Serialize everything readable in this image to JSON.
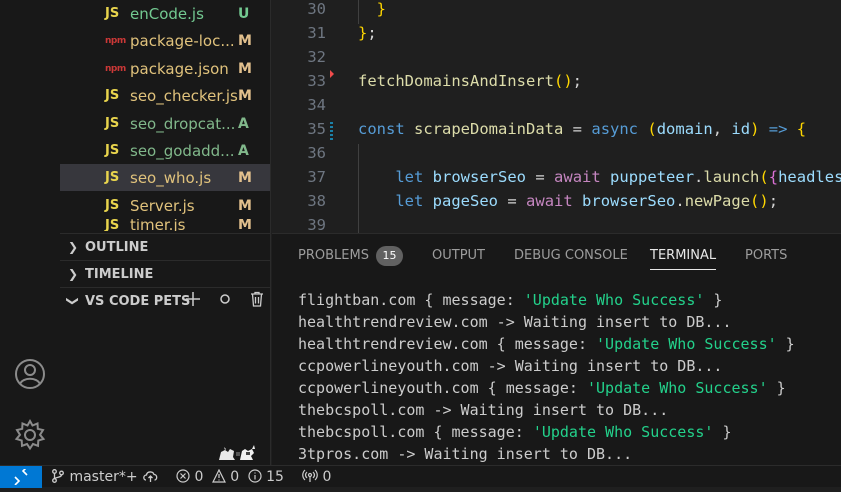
{
  "explorer": {
    "files": [
      {
        "icon": "js",
        "name": "enCode.js",
        "status": "U",
        "selected": false,
        "kind": "untracked"
      },
      {
        "icon": "npm",
        "name": "package-loc...",
        "status": "M",
        "selected": false,
        "kind": "modified"
      },
      {
        "icon": "npm",
        "name": "package.json",
        "status": "M",
        "selected": false,
        "kind": "modified"
      },
      {
        "icon": "js",
        "name": "seo_checker.js",
        "status": "M",
        "selected": false,
        "kind": "modified"
      },
      {
        "icon": "js",
        "name": "seo_dropcat...",
        "status": "A",
        "selected": false,
        "kind": "added"
      },
      {
        "icon": "js",
        "name": "seo_godadd...",
        "status": "A",
        "selected": false,
        "kind": "added"
      },
      {
        "icon": "js",
        "name": "seo_who.js",
        "status": "M",
        "selected": true,
        "kind": "modified"
      },
      {
        "icon": "js",
        "name": "Server.js",
        "status": "M",
        "selected": false,
        "kind": "modified"
      },
      {
        "icon": "js",
        "name": "timer.js",
        "status": "M",
        "selected": false,
        "kind": "modified"
      }
    ],
    "icon_labels": {
      "js": "JS",
      "npm": "npm"
    },
    "outline_title": "OUTLINE",
    "timeline_title": "TIMELINE",
    "pets_title": "VS CODE PETS"
  },
  "editor": {
    "lines": [
      {
        "n": "30",
        "text": "  }"
      },
      {
        "n": "31",
        "text": "};"
      },
      {
        "n": "32",
        "text": ""
      },
      {
        "n": "33",
        "text": "fetchDomainsAndInsert();"
      },
      {
        "n": "34",
        "text": ""
      },
      {
        "n": "35",
        "text": "const scrapeDomainData = async (domain, id) => {"
      },
      {
        "n": "36",
        "text": ""
      },
      {
        "n": "37",
        "text": "    let browserSeo = await puppeteer.launch({headless"
      },
      {
        "n": "38",
        "text": "    let pageSeo = await browserSeo.newPage();"
      },
      {
        "n": "39",
        "text": ""
      }
    ]
  },
  "panel": {
    "tabs": [
      {
        "label": "PROBLEMS",
        "active": false
      },
      {
        "label": "OUTPUT",
        "active": false
      },
      {
        "label": "DEBUG CONSOLE",
        "active": false
      },
      {
        "label": "TERMINAL",
        "active": true
      },
      {
        "label": "PORTS",
        "active": false
      }
    ],
    "problems_count": "15",
    "terminal_lines": [
      {
        "pre": "flightban.com { message: ",
        "ok": "'Update Who Success'",
        "post": " }"
      },
      {
        "pre": "healthtrendreview.com -> Waiting insert to DB...",
        "ok": "",
        "post": ""
      },
      {
        "pre": "healthtrendreview.com { message: ",
        "ok": "'Update Who Success'",
        "post": " }"
      },
      {
        "pre": "ccpowerlineyouth.com -> Waiting insert to DB...",
        "ok": "",
        "post": ""
      },
      {
        "pre": "ccpowerlineyouth.com { message: ",
        "ok": "'Update Who Success'",
        "post": " }"
      },
      {
        "pre": "thebcspoll.com -> Waiting insert to DB...",
        "ok": "",
        "post": ""
      },
      {
        "pre": "thebcspoll.com { message: ",
        "ok": "'Update Who Success'",
        "post": " }"
      },
      {
        "pre": "3tpros.com -> Waiting insert to DB...",
        "ok": "",
        "post": ""
      }
    ]
  },
  "statusbar": {
    "remote_icon": "remote-icon",
    "branch": "master*+",
    "errors": "0",
    "warnings": "0",
    "info": "15",
    "ports": "0"
  },
  "colors": {
    "accent": "#0078d4",
    "modified": "#e2c08d",
    "added": "#81b88b",
    "terminal_success": "#23d18b"
  }
}
